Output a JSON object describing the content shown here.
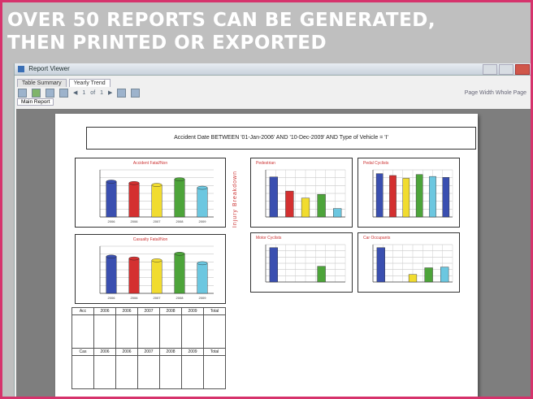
{
  "headline": {
    "line1": "OVER 50 REPORTS CAN BE GENERATED,",
    "line2": "THEN PRINTED OR EXPORTED"
  },
  "window": {
    "title": "Report Viewer"
  },
  "tabs": [
    {
      "label": "Table Summary"
    },
    {
      "label": "Yearly Trend"
    }
  ],
  "toolbar": {
    "page_current": "1",
    "page_sep": "of",
    "page_total": "1",
    "zoom_text": "Page Width   Whole Page"
  },
  "subtab": {
    "label": "Main Report"
  },
  "report": {
    "title": "Accident Date BETWEEN '01-Jan-2006' AND '10-Dec-2009' AND Type of Vehicle = 'I'",
    "side_label": "Injury Breakdown",
    "charts": {
      "c1": {
        "title": "Accident Fatal/Non",
        "ylabel": "Accidents",
        "xlabel": "Year"
      },
      "c2": {
        "title": "Casualty Fatal/Non",
        "ylabel": "Casualty",
        "xlabel": "Year"
      },
      "c3": {
        "title": "Pedestrian"
      },
      "c4": {
        "title": "Pedal Cyclists"
      },
      "c5": {
        "title": "Motor Cyclists"
      },
      "c6": {
        "title": "Car Occupants"
      }
    },
    "table_header": [
      "Acc",
      "2006",
      "2006",
      "2007",
      "2008",
      "2009",
      "Total"
    ],
    "table_header2": [
      "Cas",
      "2006",
      "2006",
      "2007",
      "2008",
      "2009",
      "Total"
    ]
  },
  "colors": {
    "blue": "#3a4fb0",
    "red": "#d43030",
    "yellow": "#f1dc2f",
    "green": "#4da43a",
    "cyan": "#6cc7e0",
    "accent": "#d6336c"
  },
  "chart_data": [
    {
      "type": "bar",
      "categories": [
        "2006",
        "2006",
        "2007",
        "2008",
        "2009"
      ],
      "values": [
        75,
        72,
        68,
        80,
        62
      ]
    },
    {
      "type": "bar",
      "categories": [
        "2006",
        "2006",
        "2007",
        "2008",
        "2009"
      ],
      "values": [
        78,
        74,
        70,
        84,
        64
      ]
    },
    {
      "type": "bar",
      "categories": [
        "",
        "",
        "",
        "",
        ""
      ],
      "values": [
        85,
        55,
        40,
        48,
        18
      ]
    },
    {
      "type": "bar",
      "categories": [
        "",
        "",
        "",
        "",
        "",
        ""
      ],
      "values": [
        92,
        88,
        82,
        90,
        86,
        84
      ]
    },
    {
      "type": "bar",
      "categories": [
        "",
        "",
        "",
        "",
        ""
      ],
      "values": [
        92,
        0,
        0,
        42,
        0
      ]
    },
    {
      "type": "bar",
      "categories": [
        "",
        "",
        "",
        "",
        ""
      ],
      "values": [
        92,
        0,
        20,
        38,
        40
      ]
    }
  ]
}
